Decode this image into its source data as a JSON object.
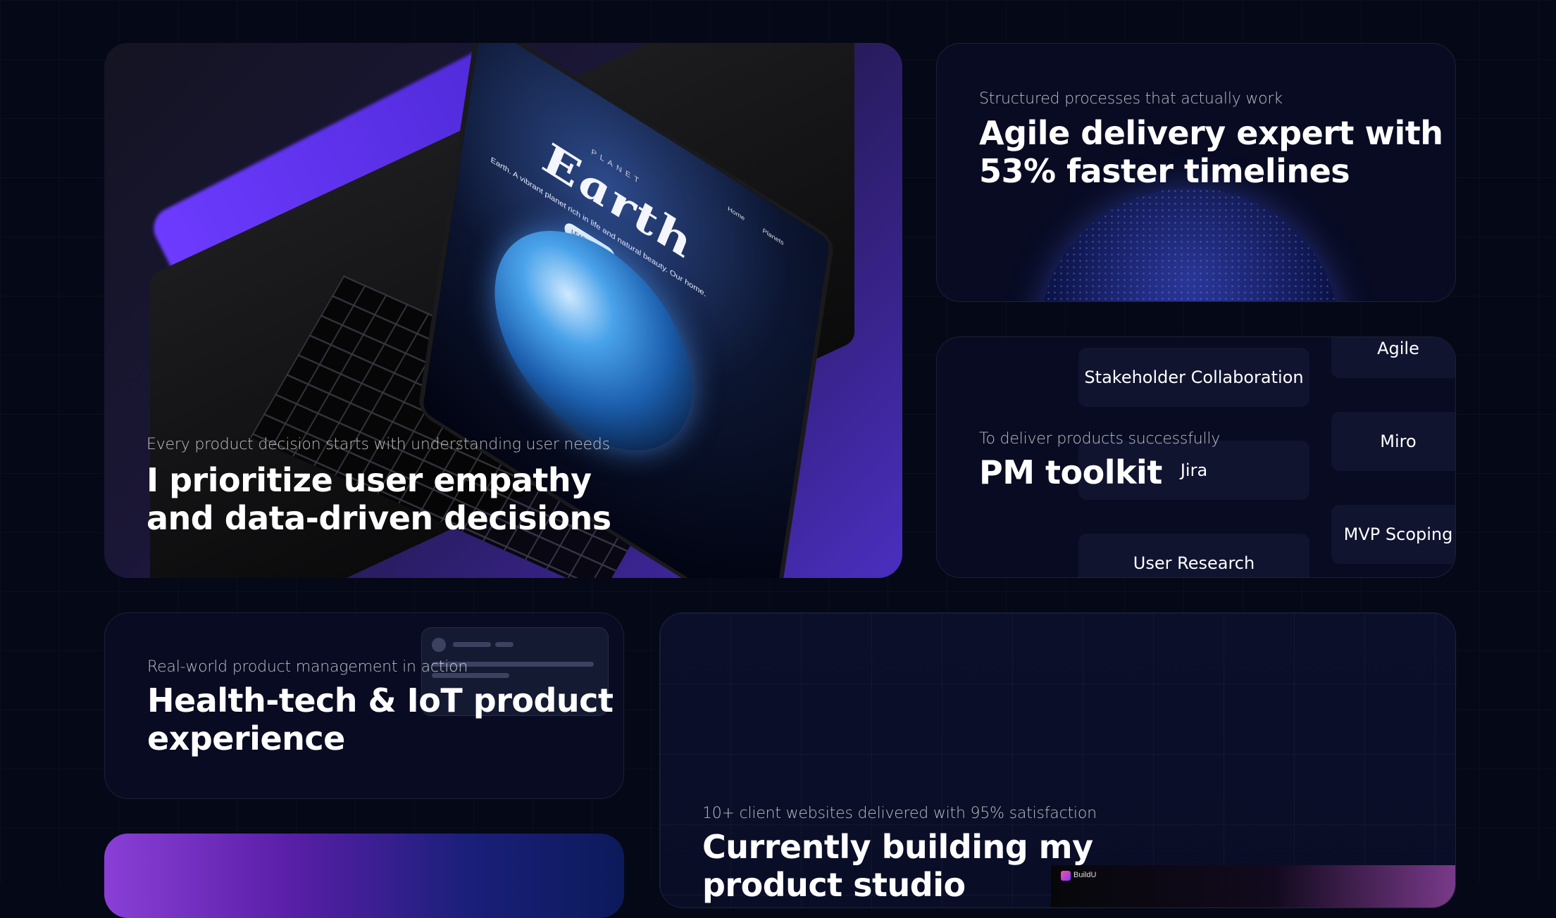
{
  "cards": {
    "empathy": {
      "subtitle": "Every product decision starts with understanding user needs",
      "heading_line1": "I prioritize user empathy",
      "heading_line2": "and data-driven decisions",
      "screen": {
        "label": "PLANET",
        "title": "Earth",
        "description": "Earth. A vibrant planet rich in life and natural beauty. Our home.",
        "button": "LEARN MORE",
        "nav": [
          "Home",
          "Planets"
        ]
      }
    },
    "agile": {
      "subtitle": "Structured processes that actually work",
      "heading_line1": "Agile delivery expert with",
      "heading_line2": "53% faster timelines"
    },
    "toolkit": {
      "subtitle": "To deliver products successfully",
      "heading": "PM toolkit",
      "chips": [
        "Stakeholder Collaboration",
        "Jira",
        "User Research",
        "Agile",
        "Miro",
        "MVP Scoping"
      ]
    },
    "health": {
      "subtitle": "Real-world product management in action",
      "heading_line1": "Health-tech & IoT product",
      "heading_line2": "experience"
    },
    "studio": {
      "subtitle": "10+ client websites delivered with 95% satisfaction",
      "heading_line1": "Currently building my",
      "heading_line2": "product studio",
      "preview_name": "BuildU"
    }
  },
  "colors": {
    "background": "#050816",
    "card": "#080b22",
    "accent_purple": "#4a2fc0",
    "chip": "#10142f"
  }
}
